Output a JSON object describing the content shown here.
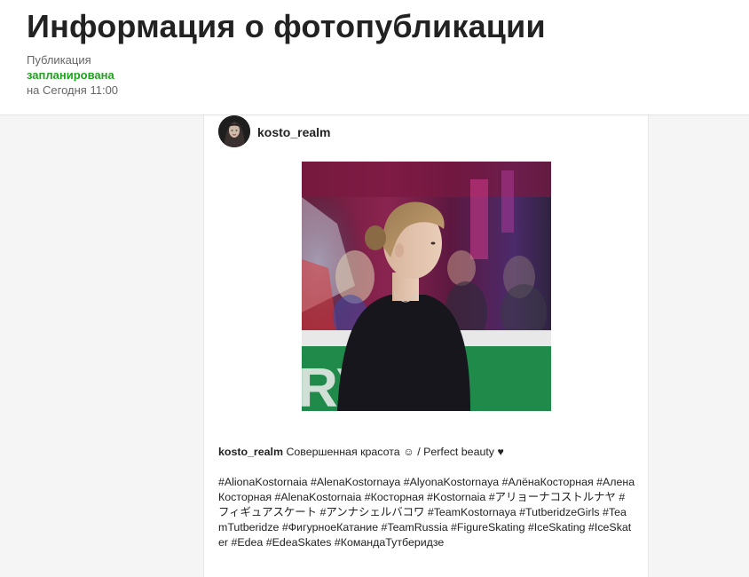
{
  "header": {
    "title": "Информация о фотопубликации",
    "publication_label": "Публикация",
    "status": "запланирована",
    "time": "на Сегодня 11:00"
  },
  "post": {
    "username": "kosto_realm",
    "caption_user": "kosto_realm",
    "caption_text": "Совершенная красота ☺ / Perfect beauty ♥",
    "hashtags": "#AlionaKostornaia #AlenaKostornaya #AlyonaKostornaya #АлёнаКосторная #АленаКосторная #AlenaKostornaia #Косторная #Kostornaia #アリョーナコストルナヤ #フィギュアスケート #アンナシェルバコワ #TeamKostornaya #TutberidzeGirls #TeamTutberidze #ФигурноеКатание #TeamRussia #FigureSkating #IceSkating #IceSkater #Edea #EdeaSkates #КомандаТутберидзе"
  },
  "colors": {
    "status_green": "#1ea31e",
    "header_bg": "#ffffff",
    "page_bg": "#f5f5f5"
  }
}
